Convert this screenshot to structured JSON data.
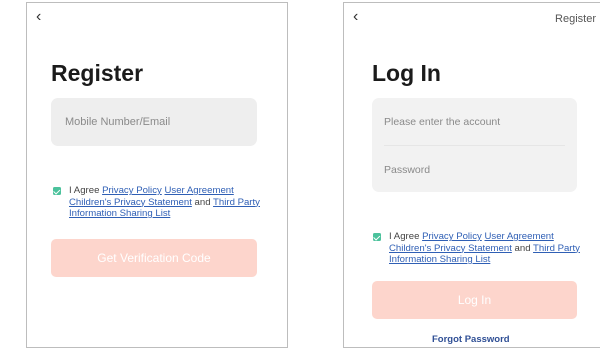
{
  "register_screen": {
    "back_icon": "chevron-left-icon",
    "title": "Register",
    "account_placeholder": "Mobile Number/Email",
    "agreement": {
      "prefix": "I Agree ",
      "privacy_policy": "Privacy Policy",
      "user_agreement": "User Agreement",
      "children_statement": "Children's Privacy Statement",
      "and": " and ",
      "third_party": "Third Party Information Sharing List",
      "checked": true
    },
    "submit_label": "Get Verification Code"
  },
  "login_screen": {
    "back_icon": "chevron-left-icon",
    "register_link": "Register",
    "title": "Log In",
    "account_placeholder": "Please enter the account",
    "password_placeholder": "Password",
    "agreement": {
      "prefix": "I Agree ",
      "privacy_policy": "Privacy Policy",
      "user_agreement": "User Agreement",
      "children_statement": "Children's Privacy Statement",
      "and": " and ",
      "third_party": "Third Party Information Sharing List",
      "checked": true
    },
    "submit_label": "Log In",
    "forgot_label": "Forgot Password"
  },
  "colors": {
    "accent_disabled": "#fdd5cc",
    "checkbox": "#4bc29c",
    "link": "#2f5fb5",
    "input_bg": "#eeeeee"
  }
}
